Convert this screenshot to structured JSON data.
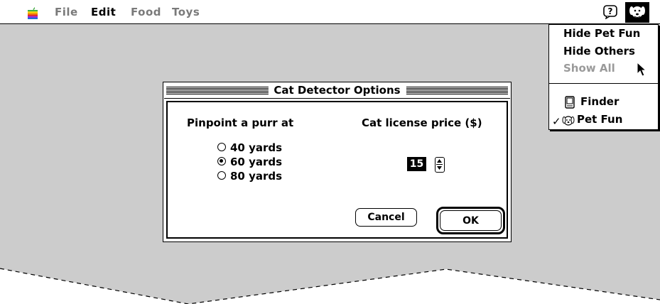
{
  "menubar": {
    "apple_icon": "apple-logo-icon",
    "menus": [
      {
        "label": "File",
        "disabled": true
      },
      {
        "label": "Edit",
        "disabled": false
      },
      {
        "label": "Food",
        "disabled": true
      },
      {
        "label": "Toys",
        "disabled": true
      }
    ],
    "help_icon": "balloon-help-icon",
    "app_icon": "pet-fun-dog-icon"
  },
  "dialog": {
    "title": "Cat Detector Options",
    "purr_label": "Pinpoint a purr at",
    "radios": [
      {
        "label": "40 yards",
        "checked": false
      },
      {
        "label": "60 yards",
        "checked": true
      },
      {
        "label": "80 yards",
        "checked": false
      }
    ],
    "price_label": "Cat license price ($)",
    "price_value": "15",
    "cancel_label": "Cancel",
    "ok_label": "OK"
  },
  "app_menu": {
    "items": [
      {
        "label": "Hide Pet Fun",
        "disabled": false
      },
      {
        "label": "Hide Others",
        "disabled": false
      },
      {
        "label": "Show All",
        "disabled": true
      }
    ],
    "apps": [
      {
        "label": "Finder",
        "icon": "finder-icon",
        "checked": false
      },
      {
        "label": "Pet Fun",
        "icon": "pet-fun-dog-icon",
        "checked": true
      }
    ],
    "check_mark": "✓"
  },
  "colors": {
    "desktop": "#cccccc",
    "disabled_text": "#7a7a7a"
  }
}
